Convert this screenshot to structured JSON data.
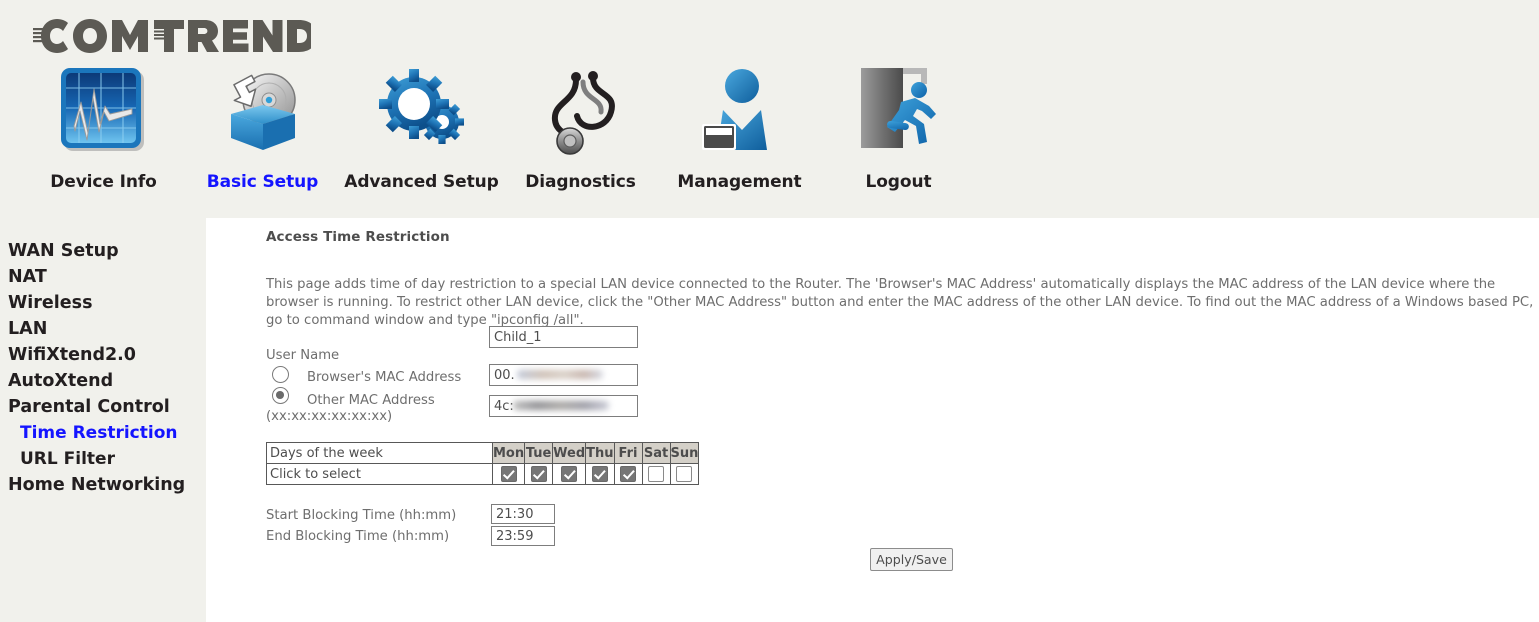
{
  "brand": {
    "logo_text": "COMTREND"
  },
  "nav": {
    "items": [
      {
        "label": "Device Info",
        "icon": "device-info-icon",
        "active": false
      },
      {
        "label": "Basic Setup",
        "icon": "basic-setup-icon",
        "active": true
      },
      {
        "label": "Advanced Setup",
        "icon": "advanced-setup-icon",
        "active": false
      },
      {
        "label": "Diagnostics",
        "icon": "diagnostics-icon",
        "active": false
      },
      {
        "label": "Management",
        "icon": "management-icon",
        "active": false
      },
      {
        "label": "Logout",
        "icon": "logout-icon",
        "active": false
      }
    ]
  },
  "sidebar": {
    "items": [
      {
        "label": "WAN Setup",
        "sub": false,
        "active": false
      },
      {
        "label": "NAT",
        "sub": false,
        "active": false
      },
      {
        "label": "Wireless",
        "sub": false,
        "active": false
      },
      {
        "label": "LAN",
        "sub": false,
        "active": false
      },
      {
        "label": "WifiXtend2.0",
        "sub": false,
        "active": false
      },
      {
        "label": "AutoXtend",
        "sub": false,
        "active": false
      },
      {
        "label": "Parental Control",
        "sub": false,
        "active": false
      },
      {
        "label": "Time Restriction",
        "sub": true,
        "active": true
      },
      {
        "label": "URL Filter",
        "sub": true,
        "active": false
      },
      {
        "label": "Home Networking",
        "sub": false,
        "active": false
      }
    ]
  },
  "main": {
    "title": "Access Time Restriction",
    "description": "This page adds time of day restriction to a special LAN device connected to the Router. The 'Browser's MAC Address' automatically displays the MAC address of the LAN device where the browser is running. To restrict other LAN device, click the \"Other MAC Address\" button and enter the MAC address of the other LAN device. To find out the MAC address of a Windows based PC, go to command window and type \"ipconfig /all\".",
    "user_name_label": "User Name",
    "user_name_value": "Child_1",
    "browser_mac_label": "Browser's MAC Address",
    "browser_mac_value": "00.",
    "browser_mac_selected": false,
    "other_mac_label": "Other MAC Address",
    "other_mac_value": "4c:",
    "other_mac_selected": true,
    "mac_format_hint": "(xx:xx:xx:xx:xx:xx)",
    "days_table": {
      "row_header_label": "Days of the week",
      "row_select_label": "Click to select",
      "days": [
        "Mon",
        "Tue",
        "Wed",
        "Thu",
        "Fri",
        "Sat",
        "Sun"
      ],
      "checked": [
        true,
        true,
        true,
        true,
        true,
        false,
        false
      ]
    },
    "start_time_label": "Start Blocking Time (hh:mm)",
    "start_time_value": "21:30",
    "end_time_label": "End Blocking Time (hh:mm)",
    "end_time_value": "23:59",
    "apply_save_label": "Apply/Save"
  },
  "colors": {
    "header_bg": "#f1f1ec",
    "accent_blue": "#1414ff",
    "text_dark": "#231f20",
    "text_muted": "#6e6e6e",
    "icon_blue": "#1b76bc",
    "table_header_bg": "#d4d0c8"
  }
}
